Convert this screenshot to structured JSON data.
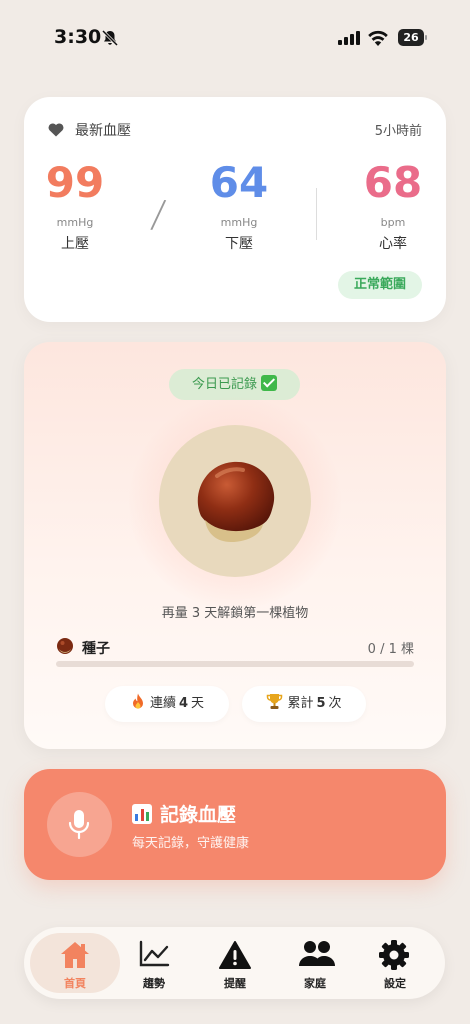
{
  "status_bar": {
    "time": "3:30",
    "battery": "26"
  },
  "bp_card": {
    "title": "最新血壓",
    "time_ago": "5小時前",
    "systolic": {
      "value": "99",
      "unit": "mmHg",
      "label": "上壓"
    },
    "diastolic": {
      "value": "64",
      "unit": "mmHg",
      "label": "下壓"
    },
    "heart_rate": {
      "value": "68",
      "unit": "bpm",
      "label": "心率"
    },
    "status_badge": "正常範圍",
    "colors": {
      "systolic": "#f27c5f",
      "diastolic": "#5f8de8",
      "heart_rate": "#ea6c8a",
      "normal": "#3aa95b"
    }
  },
  "plant_card": {
    "recorded_badge": "今日已記錄",
    "unlock_text": "再量 3 天解鎖第一棵植物",
    "stage_label": "種子",
    "stage_count": "0 / 1 棵",
    "progress": 0.0,
    "streak": {
      "prefix": "連續",
      "value": "4",
      "suffix": "天"
    },
    "total": {
      "prefix": "累計",
      "value": "5",
      "suffix": "次"
    }
  },
  "record_button": {
    "title": "記錄血壓",
    "subtitle": "每天記錄，守護健康",
    "color": "#f5876c"
  },
  "bottom_nav": {
    "items": [
      {
        "label": "首頁",
        "icon": "home-icon",
        "active": true
      },
      {
        "label": "趨勢",
        "icon": "trend-chart-icon"
      },
      {
        "label": "提醒",
        "icon": "warning-icon"
      },
      {
        "label": "家庭",
        "icon": "family-icon"
      },
      {
        "label": "設定",
        "icon": "gear-icon"
      }
    ]
  }
}
